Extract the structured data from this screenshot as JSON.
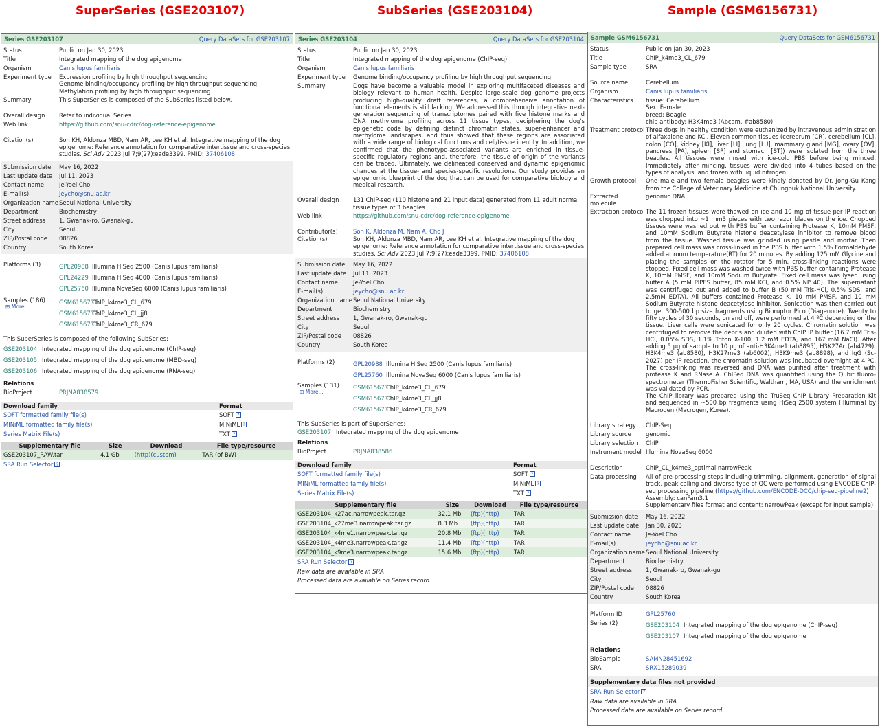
{
  "headings": {
    "superseries": "SuperSeries (GSE203107)",
    "subseries": "SubSeries (GSE203104)",
    "sample": "Sample (GSM6156731)"
  },
  "p1": {
    "title": "Series GSE203107",
    "query": "Query DataSets for GSE203107",
    "status_l": "Status",
    "status": "Public on Jan 30, 2023",
    "title_l": "Title",
    "title_v": "Integrated mapping of the dog epigenome",
    "org_l": "Organism",
    "org": "Canis lupus familiaris",
    "exp_l": "Experiment type",
    "exp": [
      "Expression profiling by high throughput sequencing",
      "Genome binding/occupancy profiling by high throughput sequencing",
      "Methylation profiling by high throughput sequencing"
    ],
    "summary_l": "Summary",
    "summary": "This SuperSeries is composed of the SubSeries listed below.",
    "design_l": "Overall design",
    "design": "Refer to individual Series",
    "web_l": "Web link",
    "web": "https://github.com/snu-cdrc/dog-reference-epigenome",
    "cit_l": "Citation(s)",
    "cit_a": "Son KH, Aldonza MBD, Nam AR, Lee KH et al. Integrative mapping of the dog epigenome: Reference annotation for comparative intertissue and cross-species studies.",
    "cit_j": "Sci Adv",
    "cit_b": "2023 Jul 7;9(27):eade3399. PMID:",
    "cit_pmid": "37406108",
    "sub_l": "Submission date",
    "sub": "May 16, 2022",
    "upd_l": "Last update date",
    "upd": "Jul 11, 2023",
    "contact_l": "Contact name",
    "contact": "Je-Yoel Cho",
    "email_l": "E-mail(s)",
    "email": "jeycho@snu.ac.kr",
    "orgn_l": "Organization name",
    "orgn": "Seoul National University",
    "dept_l": "Department",
    "dept": "Biochemistry",
    "street_l": "Street address",
    "street": "1, Gwanak-ro, Gwanak-gu",
    "city_l": "City",
    "city": "Seoul",
    "zip_l": "ZIP/Postal code",
    "zip": "08826",
    "country_l": "Country",
    "country": "South Korea",
    "plat_l": "Platforms (3)",
    "platforms": [
      {
        "id": "GPL20988",
        "name": "Illumina HiSeq 2500 (Canis lupus familiaris)"
      },
      {
        "id": "GPL24229",
        "name": "Illumina HiSeq 4000 (Canis lupus familiaris)"
      },
      {
        "id": "GPL25760",
        "name": "Illumina NovaSeq 6000 (Canis lupus familiaris)"
      }
    ],
    "samp_l": "Samples (186)",
    "more": "More...",
    "samples": [
      {
        "id": "GSM6156731",
        "name": "ChIP_k4me3_CL_679"
      },
      {
        "id": "GSM6156732",
        "name": "ChIP_k4me3_CL_jj8"
      },
      {
        "id": "GSM6156733",
        "name": "ChIP_k4me3_CR_679"
      }
    ],
    "subseries_intro": "This SuperSeries is composed of the following SubSeries:",
    "subseries": [
      {
        "id": "GSE203104",
        "name": "Integrated mapping of the dog epigenome (ChIP-seq)"
      },
      {
        "id": "GSE203105",
        "name": "Integrated mapping of the dog epigenome (MBD-seq)"
      },
      {
        "id": "GSE203106",
        "name": "Integrated mapping of the dog epigenome (RNA-seq)"
      }
    ],
    "rel_h": "Relations",
    "bioproj_l": "BioProject",
    "bioproj": "PRJNA838579",
    "df_h1": "Download family",
    "df_h2": "Format",
    "downloads": [
      {
        "name": "SOFT formatted family file(s)",
        "fmt": "SOFT"
      },
      {
        "name": "MINiML formatted family file(s)",
        "fmt": "MINiML"
      },
      {
        "name": "Series Matrix File(s)",
        "fmt": "TXT"
      }
    ],
    "sf_h": [
      "Supplementary file",
      "Size",
      "Download",
      "File type/resource"
    ],
    "suppl": [
      {
        "file": "GSE203107_RAW.tar",
        "size": "4.1 Gb",
        "dl": "(http)(custom)",
        "type": "TAR (of BW)"
      }
    ],
    "sra": "SRA Run Selector"
  },
  "p2": {
    "title": "Series GSE203104",
    "query": "Query DataSets for GSE203104",
    "status_l": "Status",
    "status": "Public on Jan 30, 2023",
    "title_l": "Title",
    "title_v": "Integrated mapping of the dog epigenome (ChIP-seq)",
    "org_l": "Organism",
    "org": "Canis lupus familiaris",
    "exp_l": "Experiment type",
    "exp": "Genome binding/occupancy profiling by high throughput sequencing",
    "summary_l": "Summary",
    "summary": "Dogs have become a valuable model in exploring multifaceted diseases and biology relevant to human health. Despite large-scale dog genome projects producing high-quality draft references, a comprehensive annotation of functional elements is still lacking. We addressed this through integrative next-generation sequencing of transcriptomes paired with five histone marks and DNA methylome profiling across 11 tissue types, deciphering the dog's epigenetic code by defining distinct chromatin states, super-enhancer and methylome landscapes, and thus showed that these regions are associated with a wide range of biological functions and cell/tissue identity. In addition, we confirmed that the phenotype-associated variants are enriched in tissue-specific regulatory regions and, therefore, the tissue of origin of the variants can be traced. Ultimately, we delineated conserved and dynamic epigenomic changes at the tissue- and species-specific resolutions. Our study provides an epigenomic blueprint of the dog that can be used for comparative biology and medical research.",
    "design_l": "Overall design",
    "design": "131 ChIP-seq (110 histone and 21 input data) generated from 11 adult normal tissue types of 3 beagles",
    "web_l": "Web link",
    "web": "https://github.com/snu-cdrc/dog-reference-epigenome",
    "contrib_l": "Contributor(s)",
    "contrib": [
      "Son K",
      "Aldonza M",
      "Nam A",
      "Cho J"
    ],
    "cit_l": "Citation(s)",
    "cit_a": "Son KH, Aldonza MBD, Nam AR, Lee KH et al. Integrative mapping of the dog epigenome: Reference annotation for comparative intertissue and cross-species studies.",
    "cit_j": "Sci Adv",
    "cit_b": "2023 Jul 7;9(27):eade3399. PMID:",
    "cit_pmid": "37406108",
    "sub_l": "Submission date",
    "sub": "May 16, 2022",
    "upd_l": "Last update date",
    "upd": "Jul 11, 2023",
    "contact_l": "Contact name",
    "contact": "Je-Yoel Cho",
    "email_l": "E-mail(s)",
    "email": "jeycho@snu.ac.kr",
    "orgn_l": "Organization name",
    "orgn": "Seoul National University",
    "dept_l": "Department",
    "dept": "Biochemistry",
    "street_l": "Street address",
    "street": "1, Gwanak-ro, Gwanak-gu",
    "city_l": "City",
    "city": "Seoul",
    "zip_l": "ZIP/Postal code",
    "zip": "08826",
    "country_l": "Country",
    "country": "South Korea",
    "plat_l": "Platforms (2)",
    "platforms": [
      {
        "id": "GPL20988",
        "name": "Illumina HiSeq 2500 (Canis lupus familiaris)"
      },
      {
        "id": "GPL25760",
        "name": "Illumina NovaSeq 6000 (Canis lupus familiaris)"
      }
    ],
    "samp_l": "Samples (131)",
    "more": "More...",
    "samples": [
      {
        "id": "GSM6156731",
        "name": "ChIP_k4me3_CL_679"
      },
      {
        "id": "GSM6156732",
        "name": "ChIP_k4me3_CL_jj8"
      },
      {
        "id": "GSM6156733",
        "name": "ChIP_k4me3_CR_679"
      }
    ],
    "super_intro": "This SubSeries is part of SuperSeries:",
    "super_id": "GSE203107",
    "super_name": "Integrated mapping of the dog epigenome",
    "rel_h": "Relations",
    "bioproj_l": "BioProject",
    "bioproj": "PRJNA838586",
    "df_h1": "Download family",
    "df_h2": "Format",
    "downloads": [
      {
        "name": "SOFT formatted family file(s)",
        "fmt": "SOFT"
      },
      {
        "name": "MINiML formatted family file(s)",
        "fmt": "MINiML"
      },
      {
        "name": "Series Matrix File(s)",
        "fmt": "TXT"
      }
    ],
    "sf_h": [
      "Supplementary file",
      "Size",
      "Download",
      "File type/resource"
    ],
    "suppl": [
      {
        "file": "GSE203104_k27ac.narrowpeak.tar.gz",
        "size": "32.1 Mb",
        "dl": "(ftp)(http)",
        "type": "TAR"
      },
      {
        "file": "GSE203104_k27me3.narrowpeak.tar.gz",
        "size": "8.3 Mb",
        "dl": "(ftp)(http)",
        "type": "TAR"
      },
      {
        "file": "GSE203104_k4me1.narrowpeak.tar.gz",
        "size": "20.8 Mb",
        "dl": "(ftp)(http)",
        "type": "TAR"
      },
      {
        "file": "GSE203104_k4me3.narrowpeak.tar.gz",
        "size": "11.4 Mb",
        "dl": "(ftp)(http)",
        "type": "TAR"
      },
      {
        "file": "GSE203104_k9me3.narrowpeak.tar.gz",
        "size": "15.6 Mb",
        "dl": "(ftp)(http)",
        "type": "TAR"
      }
    ],
    "sra": "SRA Run Selector",
    "note1": "Raw data are available in SRA",
    "note2": "Processed data are available on Series record"
  },
  "p3": {
    "title": "Sample GSM6156731",
    "query": "Query DataSets for GSM6156731",
    "status_l": "Status",
    "status": "Public on Jan 30, 2023",
    "title_l": "Title",
    "title_v": "ChIP_k4me3_CL_679",
    "stype_l": "Sample type",
    "stype": "SRA",
    "src_l": "Source name",
    "src": "Cerebellum",
    "org_l": "Organism",
    "org": "Canis lupus familiaris",
    "char_l": "Characteristics",
    "chars": [
      "tissue: Cerebellum",
      "Sex: Female",
      "breed: Beagle",
      "chip antibody: H3K4me3 (Abcam, #ab8580)"
    ],
    "treat_l": "Treatment protocol",
    "treat": "Three dogs in healthy condition were euthanized by intravenous administration of alfaxalone and KCl. Eleven common tissues (cerebrum [CR], cerebellum [CL], colon [CO], kidney [KI], liver [LI], lung [LU], mammary gland [MG], ovary [OV], pancreas [PA], spleen [SP] and stomach [ST]) were isolated from the three beagles. All tissues were rinsed with ice-cold PBS before being minced. Immediately after mincing, tissues were divided into 4 tubes based on the types of analysis, and frozen with liquid nitrogen",
    "growth_l": "Growth protocol",
    "growth": "One male and two female beagles were kindly donated by Dr. Jong-Gu Kang from the College of Veterinary Medicine at Chungbuk National University.",
    "extm_l": "Extracted molecule",
    "extm": "genomic DNA",
    "extp_l": "Extraction protocol",
    "extp": "The 11 frozen tissues were thawed on ice and 10 mg of tissue per IP reaction was chopped into ~1 mm3 pieces with two razor blades on the ice. Chopped tissues were washed out with PBS buffer containing Protease K, 10mM PMSF, and 10mM Sodium Butyrate histone deacetylase inhibitor to remove blood from the tissue. Washed tissue was grinded using pestle and mortar. Then prepared cell mass was cross-linked in the PBS buffer with 1.5% Formaldehyde added at room temperature(RT) for 20 minutes. By adding 125 mM Glycine and placing the samples on the rotator for 5 min, cross-linking reactions were stopped. Fixed cell mass was washed twice with PBS buffer containing Protease K, 10mM PMSF, and 10mM Sodium Butyrate. Fixed cell mass was lysed using buffer A (5 mM PIPES buffer, 85 mM KCl, and 0.5% NP 40). The supernatant was centrifuged out and added to buffer B (50 mM Tris-HCl, 0.5% SDS, and 2.5mM EDTA). All buffers contained Protease K, 10 mM PMSF, and 10 mM Sodium Butyrate histone deacetylase inhibitor. Sonication was then carried out to get 300-500 bp size fragments using Bioruptor Pico (Diagenode). Twenty to fifty cycles of 30 seconds, on and off, were performed at 4 ºC depending on the tissue. Liver cells were sonicated for only 20 cycles. Chromatin solution was centrifuged to remove the debris and diluted with ChIP IP buffer (16.7 mM Tris-HCl, 0.05% SDS, 1.1% Triton X-100, 1.2 mM EDTA, and 167 mM NaCl). After adding 5 μg of sample to 10 μg of anti-H3K4me1 (ab8895), H3K27Ac (ab4729), H3K4me3 (ab8580), H3K27me3 (ab6002), H3K9me3 (ab8898), and IgG (Sc-2027) per IP reaction, the chromatin solution was incubated overnight at 4 ºC. The cross-linking was reversed and DNA was purified after treatment with protease K and RNase A. ChIPed DNA was quantified using the Qubit fluoro-spectrometer (ThermoFisher Scientific, Waltham, MA, USA) and the enrichment was validated by PCR.",
    "extp2": "The ChIP library was prepared using the TruSeq ChIP Library Preparation Kit and sequenced in ~500 bp fragments using HiSeq 2500 system (Illumina) by Macrogen (Macrogen, Korea).",
    "lstrat_l": "Library strategy",
    "lstrat": "ChIP-Seq",
    "lsrc_l": "Library source",
    "lsrc": "genomic",
    "lsel_l": "Library selection",
    "lsel": "ChIP",
    "instr_l": "Instrument model",
    "instr": "Illumina NovaSeq 6000",
    "desc_l": "Description",
    "desc": "ChIP_CL_k4me3_optimal.narrowPeak",
    "dp_l": "Data processing",
    "dp_a": "All of pre-processing steps including trimming, alignment, generation of signal track, peak calling and diverse type of QC were performed using ENCODE ChIP-seq processing pipeline (",
    "dp_link": "https://github.com/ENCODE-DCC/chip-seq-pipeline2",
    "dp_b": ")",
    "dp_asm": "Assembly: canFam3.1",
    "dp_sfc": "Supplementary files format and content: narrowPeak (except for Input sample)",
    "sub_l": "Submission date",
    "sub": "May 16, 2022",
    "upd_l": "Last update date",
    "upd": "Jan 30, 2023",
    "contact_l": "Contact name",
    "contact": "Je-Yoel Cho",
    "email_l": "E-mail(s)",
    "email": "jeycho@snu.ac.kr",
    "orgn_l": "Organization name",
    "orgn": "Seoul National University",
    "dept_l": "Department",
    "dept": "Biochemistry",
    "street_l": "Street address",
    "street": "1, Gwanak-ro, Gwanak-gu",
    "city_l": "City",
    "city": "Seoul",
    "zip_l": "ZIP/Postal code",
    "zip": "08826",
    "country_l": "Country",
    "country": "South Korea",
    "plat_l": "Platform ID",
    "plat": "GPL25760",
    "series_l": "Series (2)",
    "series": [
      {
        "id": "GSE203104",
        "name": "Integrated mapping of the dog epigenome (ChIP-seq)"
      },
      {
        "id": "GSE203107",
        "name": "Integrated mapping of the dog epigenome"
      }
    ],
    "rel_h": "Relations",
    "biosample_l": "BioSample",
    "biosample": "SAMN28451692",
    "sra_l": "SRA",
    "sra_id": "SRX15289039",
    "nosupp": "Supplementary data files not provided",
    "sra": "SRA Run Selector",
    "note1": "Raw data are available in SRA",
    "note2": "Processed data are available on Series record"
  }
}
